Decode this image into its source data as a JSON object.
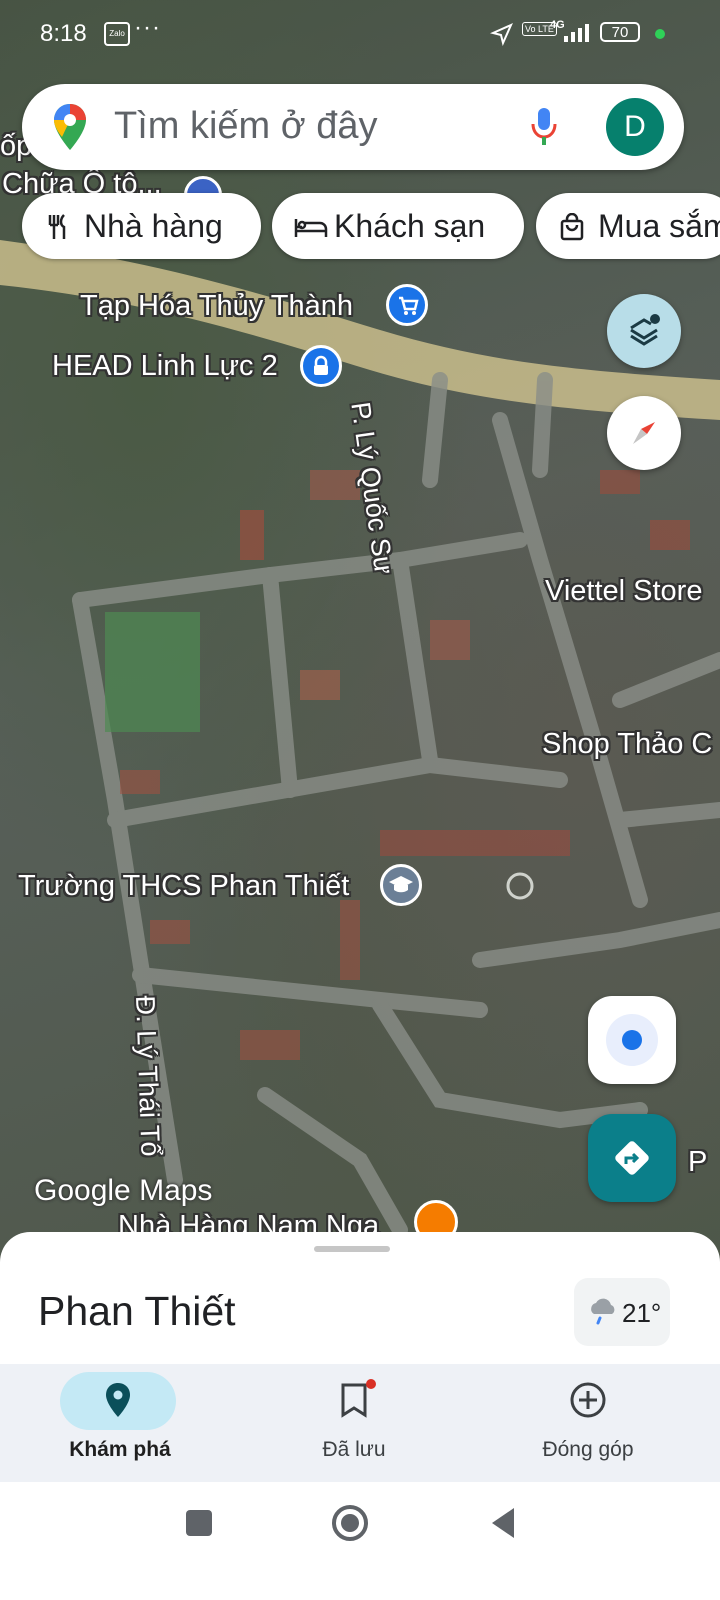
{
  "status_bar": {
    "time": "8:18",
    "notif_app": "Zalo",
    "more": "···",
    "volte": "Vo LTE",
    "network": "4G",
    "battery": "70"
  },
  "search": {
    "placeholder": "Tìm kiếm ở đây",
    "avatar_letter": "D"
  },
  "chips": [
    {
      "label": "Nhà hàng",
      "icon": "restaurant-icon"
    },
    {
      "label": "Khách sạn",
      "icon": "hotel-icon"
    },
    {
      "label": "Mua sắm",
      "icon": "shopping-bag-icon"
    }
  ],
  "map": {
    "labels": {
      "partial_top": "ốp",
      "chua_oto": "Chữa Ô tô...",
      "tap_hoa": "Tạp Hóa Thủy Thành",
      "head_linh_luc": "HEAD Linh Lực 2",
      "street_ly_quoc_su": "P. Lý Quốc Sư",
      "viettel": "Viettel Store",
      "shop_thao": "Shop Thảo C",
      "truong_thcs": "Trường THCS Phan Thiết",
      "street_ly_thai_to": "Đ. Lý Thái Tổ",
      "nha_hang_nam_nga": "Nhà Hàng Nam Nga",
      "partial_p": "P",
      "watermark": "Google Maps"
    }
  },
  "sheet": {
    "title": "Phan Thiết",
    "weather_temp": "21°"
  },
  "bottom_nav": [
    {
      "label": "Khám phá",
      "active": true
    },
    {
      "label": "Đã lưu",
      "active": false
    },
    {
      "label": "Đóng góp",
      "active": false
    }
  ],
  "colors": {
    "accent_teal": "#0b7f8a",
    "avatar_green": "#06806d",
    "active_pill": "#c4e9f5",
    "poi_blue": "#1a73e8",
    "poi_orange": "#f57c00"
  }
}
